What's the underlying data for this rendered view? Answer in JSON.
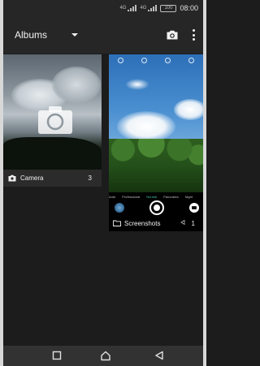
{
  "status_bar": {
    "time": "08:00",
    "battery": "100",
    "signal_labels": [
      "4G",
      "4G"
    ]
  },
  "header": {
    "title": "Albums"
  },
  "albums": [
    {
      "name": "Camera",
      "count": "3"
    },
    {
      "name": "Screenshots",
      "count": "1"
    }
  ],
  "screenshot_thumbnail": {
    "camera_modes": [
      "Auto",
      "Professional",
      "Normal",
      "Panorama",
      "Night"
    ],
    "active_mode": "Normal"
  },
  "icons": {
    "dropdown": "caret-down-icon",
    "camera": "camera-icon",
    "more": "more-vert-icon",
    "folder": "folder-icon",
    "nav_back": "square-icon",
    "nav_home": "home-icon",
    "nav_recents": "triangle-back-icon"
  },
  "colors": {
    "background": "#1c1c1c",
    "bar": "#262626",
    "nav_bar": "#323232",
    "accent": "#3ec3a8"
  }
}
